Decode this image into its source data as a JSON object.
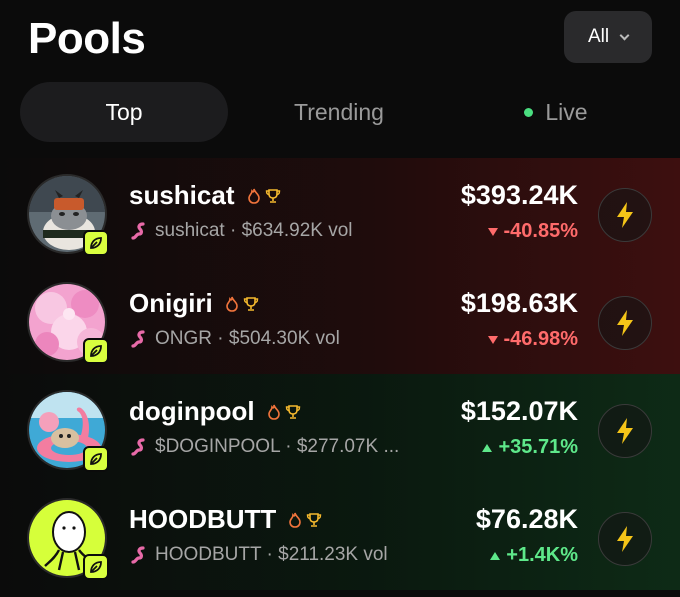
{
  "header": {
    "title": "Pools",
    "filter": {
      "value": "All"
    }
  },
  "tabs": [
    {
      "label": "Top",
      "active": true
    },
    {
      "label": "Trending",
      "active": false
    },
    {
      "label": "Live",
      "active": false
    }
  ],
  "pools": [
    {
      "name": "sushicat",
      "subtitle": "sushicat · $634.92K vol",
      "price": "$393.24K",
      "change": "-40.85%",
      "direction": "down"
    },
    {
      "name": "Onigiri",
      "subtitle": "ONGR · $504.30K vol",
      "price": "$198.63K",
      "change": "-46.98%",
      "direction": "down"
    },
    {
      "name": "doginpool",
      "subtitle": "$DOGINPOOL · $277.07K ...",
      "price": "$152.07K",
      "change": "+35.71%",
      "direction": "up"
    },
    {
      "name": "HOODBUTT",
      "subtitle": "HOODBUTT · $211.23K vol",
      "price": "$76.28K",
      "change": "+1.4K%",
      "direction": "up"
    }
  ],
  "colors": {
    "accent_lime": "#d9ff3f",
    "negative": "#ff6b6b",
    "positive": "#5ee88a",
    "live_dot": "#4ade80",
    "bolt": "#f5c518"
  },
  "icons": {
    "row_badge": "leaf-icon",
    "badges": [
      "flame-icon",
      "trophy-icon"
    ],
    "source": "pump-icon",
    "action": "lightning-icon",
    "filter": "chevron-down-icon"
  }
}
